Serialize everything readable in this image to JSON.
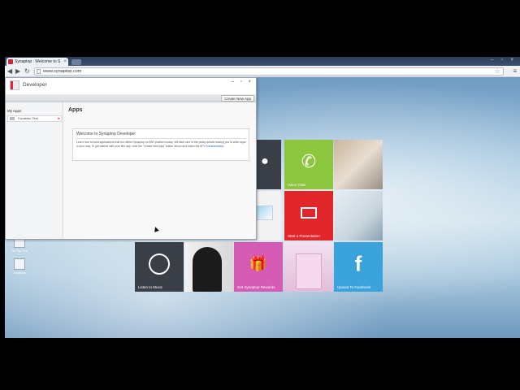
{
  "browser": {
    "tab_title": "Synaptop : Welcome to S",
    "tab_close": "×",
    "url": "www.synaptop.com",
    "window_controls": "– ▫ ×",
    "nav_back": "◀",
    "nav_forward": "▶",
    "reload": "↻",
    "star": "☆",
    "menu": "≡"
  },
  "developer_window": {
    "title": "Developer",
    "controls": "– ▫ ×",
    "create_button": "Create New App",
    "sidebar_heading": "My Apps",
    "sidebar_item": "Curabitur Test",
    "sidebar_arrow": "▸",
    "main_heading": "Apps",
    "welcome_title": "Welcome to Synaptop Developer",
    "welcome_body": "Learn how to build applications that run within Synaptop on ANY platform today. We take care of the pesky details leaving you to write apps in your way. To get started with your first app, click the \"Create New App\" button above and follow the API",
    "welcome_link": "Documentation."
  },
  "tiles": {
    "voice_chat": "Voice Chat",
    "start_presentation": "Start a Presentation",
    "listen_music": "Listen to Music",
    "rewards": "Get Synaptop Rewards",
    "facebook": "Upload To Facebook",
    "phone_glyph": "✆",
    "facebook_glyph": "f",
    "gift_glyph": "🎁"
  },
  "desktop_icons": {
    "icon1": "Tic Tac Toe",
    "icon2": "Dropbox"
  },
  "colors": {
    "accent_red": "#d9253e",
    "voice_green": "#8cc63e",
    "presentation_red": "#e0262a",
    "rewards_pink": "#d55bb5",
    "facebook_blue": "#3ba3db",
    "dark_tile": "#3a3e46"
  }
}
